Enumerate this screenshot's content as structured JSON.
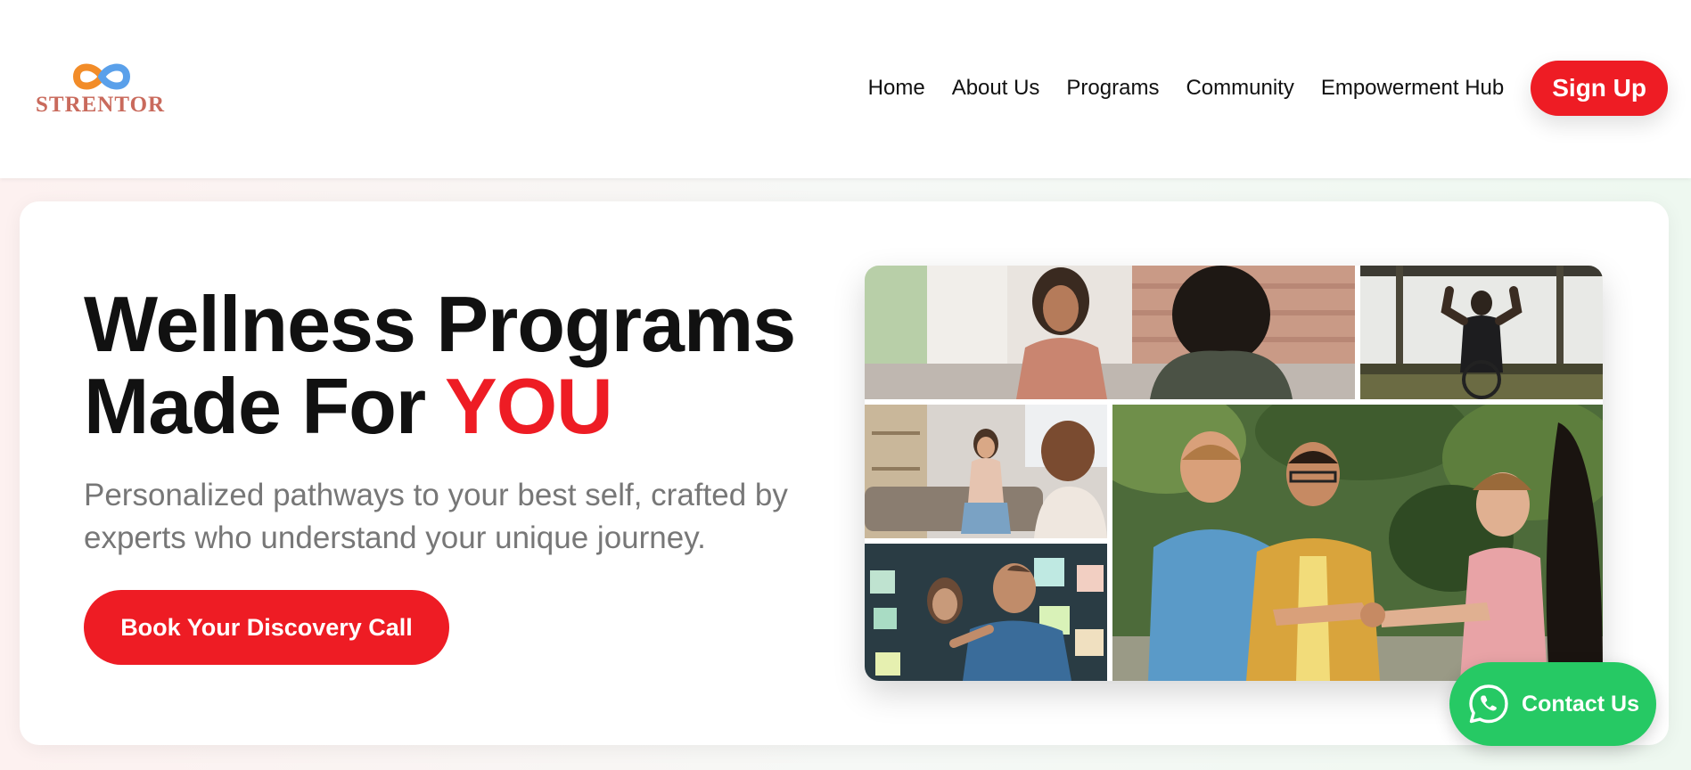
{
  "brand": {
    "name": "STRENTOR",
    "logo_icon": "infinity-logo-icon",
    "colors": {
      "orange": "#f28c28",
      "blue": "#5aa0ea",
      "text": "#c96a5c"
    }
  },
  "nav": {
    "items": [
      {
        "label": "Home"
      },
      {
        "label": "About Us"
      },
      {
        "label": "Programs"
      },
      {
        "label": "Community"
      },
      {
        "label": "Empowerment Hub"
      }
    ],
    "signup_label": "Sign Up"
  },
  "hero": {
    "title_line1": "Wellness Programs",
    "title_line2_prefix": "Made For ",
    "title_accent": "YOU",
    "subtitle": "Personalized pathways to your best self, crafted by experts who understand your unique journey.",
    "cta_label": "Book Your Discovery Call"
  },
  "collage": {
    "photos": [
      {
        "icon": "counseling-session-photo"
      },
      {
        "icon": "wheelchair-strength-photo"
      },
      {
        "icon": "therapy-couch-photo"
      },
      {
        "icon": "team-fist-bump-photo"
      },
      {
        "icon": "sticky-notes-brainstorm-photo"
      }
    ]
  },
  "contact": {
    "label": "Contact Us",
    "icon": "whatsapp-icon"
  },
  "colors": {
    "accent_red": "#ee1c24",
    "whatsapp_green": "#26c964",
    "subtitle_gray": "#777777"
  }
}
